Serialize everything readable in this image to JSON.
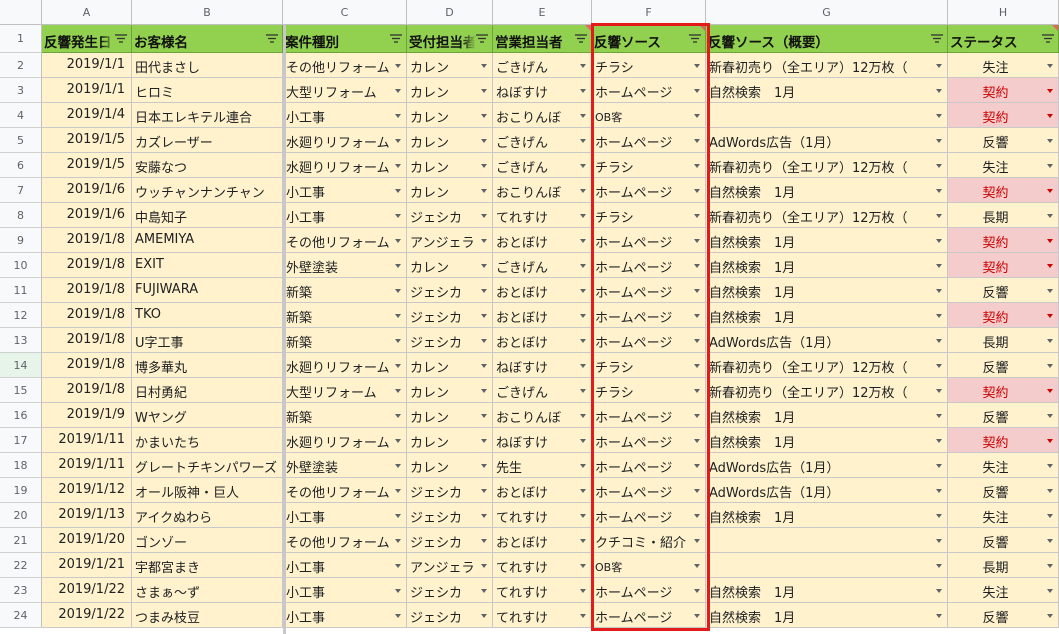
{
  "columns": [
    "A",
    "B",
    "C",
    "D",
    "E",
    "F",
    "G",
    "H"
  ],
  "headers": [
    "反響発生日",
    "お客様名",
    "案件種別",
    "受付担当者",
    "営業担当者",
    "反響ソース",
    "反響ソース（概要）",
    "ステータス"
  ],
  "header_note_cols": [
    4,
    5,
    7
  ],
  "colors": {
    "header_bg": "#92d050",
    "cell_bg": "#fff2cc",
    "contract_bg": "#f4cccc",
    "contract_text": "#cc0000",
    "highlight_border": "#e31b1b"
  },
  "icons": {
    "filter": "filter-icon",
    "dropdown": "chevron-down-icon"
  },
  "rows": [
    {
      "n": "2",
      "date": "2019/1/1",
      "name": "田代まさし",
      "type": "その他リフォーム",
      "recv": "カレン",
      "sales": "ごきげん",
      "source": "チラシ",
      "summary": "新春初売り（全エリア）12万枚（",
      "status": "失注"
    },
    {
      "n": "3",
      "date": "2019/1/1",
      "name": "ヒロミ",
      "type": "大型リフォーム",
      "recv": "カレン",
      "sales": "ねぼすけ",
      "source": "ホームページ",
      "summary": "自然検索　1月",
      "status": "契約"
    },
    {
      "n": "4",
      "date": "2019/1/4",
      "name": "日本エレキテル連合",
      "type": "小工事",
      "recv": "カレン",
      "sales": "おこりんぼ",
      "source": "OB客",
      "summary": "",
      "status": "契約"
    },
    {
      "n": "5",
      "date": "2019/1/5",
      "name": "カズレーザー",
      "type": "水廻りリフォーム",
      "recv": "カレン",
      "sales": "ごきげん",
      "source": "ホームページ",
      "summary": "AdWords広告（1月）",
      "status": "反響"
    },
    {
      "n": "6",
      "date": "2019/1/5",
      "name": "安藤なつ",
      "type": "水廻りリフォーム",
      "recv": "カレン",
      "sales": "ごきげん",
      "source": "チラシ",
      "summary": "新春初売り（全エリア）12万枚（",
      "status": "失注"
    },
    {
      "n": "7",
      "date": "2019/1/6",
      "name": "ウッチャンナンチャン",
      "type": "小工事",
      "recv": "カレン",
      "sales": "おこりんぼ",
      "source": "ホームページ",
      "summary": "自然検索　1月",
      "status": "契約"
    },
    {
      "n": "8",
      "date": "2019/1/6",
      "name": "中島知子",
      "type": "小工事",
      "recv": "ジェシカ",
      "sales": "てれすけ",
      "source": "チラシ",
      "summary": "新春初売り（全エリア）12万枚（",
      "status": "長期"
    },
    {
      "n": "9",
      "date": "2019/1/8",
      "name": "AMEMIYA",
      "type": "その他リフォーム",
      "recv": "アンジェラ",
      "sales": "おとぼけ",
      "source": "ホームページ",
      "summary": "自然検索　1月",
      "status": "契約"
    },
    {
      "n": "10",
      "date": "2019/1/8",
      "name": "EXIT",
      "type": "外壁塗装",
      "recv": "カレン",
      "sales": "ごきげん",
      "source": "ホームページ",
      "summary": "自然検索　1月",
      "status": "契約"
    },
    {
      "n": "11",
      "date": "2019/1/8",
      "name": "FUJIWARA",
      "type": "新築",
      "recv": "ジェシカ",
      "sales": "おとぼけ",
      "source": "ホームページ",
      "summary": "自然検索　1月",
      "status": "反響"
    },
    {
      "n": "12",
      "date": "2019/1/8",
      "name": "TKO",
      "type": "新築",
      "recv": "ジェシカ",
      "sales": "おとぼけ",
      "source": "ホームページ",
      "summary": "自然検索　1月",
      "status": "契約"
    },
    {
      "n": "13",
      "date": "2019/1/8",
      "name": "U字工事",
      "type": "新築",
      "recv": "ジェシカ",
      "sales": "おとぼけ",
      "source": "ホームページ",
      "summary": "AdWords広告（1月）",
      "status": "長期"
    },
    {
      "n": "14",
      "date": "2019/1/8",
      "name": "博多華丸",
      "type": "水廻りリフォーム",
      "recv": "カレン",
      "sales": "ねぼすけ",
      "source": "チラシ",
      "summary": "新春初売り（全エリア）12万枚（",
      "status": "反響"
    },
    {
      "n": "15",
      "date": "2019/1/8",
      "name": "日村勇紀",
      "type": "大型リフォーム",
      "recv": "カレン",
      "sales": "ごきげん",
      "source": "チラシ",
      "summary": "新春初売り（全エリア）12万枚（",
      "status": "契約"
    },
    {
      "n": "16",
      "date": "2019/1/9",
      "name": "Wヤング",
      "type": "新築",
      "recv": "カレン",
      "sales": "おこりんぼ",
      "source": "ホームページ",
      "summary": "自然検索　1月",
      "status": "反響"
    },
    {
      "n": "17",
      "date": "2019/1/11",
      "name": "かまいたち",
      "type": "水廻りリフォーム",
      "recv": "カレン",
      "sales": "ねぼすけ",
      "source": "ホームページ",
      "summary": "自然検索　1月",
      "status": "契約"
    },
    {
      "n": "18",
      "date": "2019/1/11",
      "name": "グレートチキンパワーズ",
      "type": "外壁塗装",
      "recv": "カレン",
      "sales": "先生",
      "source": "ホームページ",
      "summary": "AdWords広告（1月）",
      "status": "失注"
    },
    {
      "n": "19",
      "date": "2019/1/12",
      "name": "オール阪神・巨人",
      "type": "その他リフォーム",
      "recv": "ジェシカ",
      "sales": "おとぼけ",
      "source": "ホームページ",
      "summary": "AdWords広告（1月）",
      "status": "反響"
    },
    {
      "n": "20",
      "date": "2019/1/13",
      "name": "アイクぬわら",
      "type": "小工事",
      "recv": "ジェシカ",
      "sales": "てれすけ",
      "source": "ホームページ",
      "summary": "自然検索　1月",
      "status": "失注"
    },
    {
      "n": "21",
      "date": "2019/1/20",
      "name": "ゴンゾー",
      "type": "その他リフォーム",
      "recv": "ジェシカ",
      "sales": "おとぼけ",
      "source": "クチコミ・紹介",
      "summary": "",
      "status": "反響"
    },
    {
      "n": "22",
      "date": "2019/1/21",
      "name": "宇都宮まき",
      "type": "小工事",
      "recv": "アンジェラ",
      "sales": "てれすけ",
      "source": "OB客",
      "summary": "",
      "status": "長期"
    },
    {
      "n": "23",
      "date": "2019/1/22",
      "name": "さまぁ～ず",
      "type": "小工事",
      "recv": "ジェシカ",
      "sales": "てれすけ",
      "source": "ホームページ",
      "summary": "自然検索　1月",
      "status": "失注"
    },
    {
      "n": "24",
      "date": "2019/1/22",
      "name": "つまみ枝豆",
      "type": "小工事",
      "recv": "ジェシカ",
      "sales": "てれすけ",
      "source": "ホームページ",
      "summary": "自然検索　1月",
      "status": "反響"
    }
  ]
}
